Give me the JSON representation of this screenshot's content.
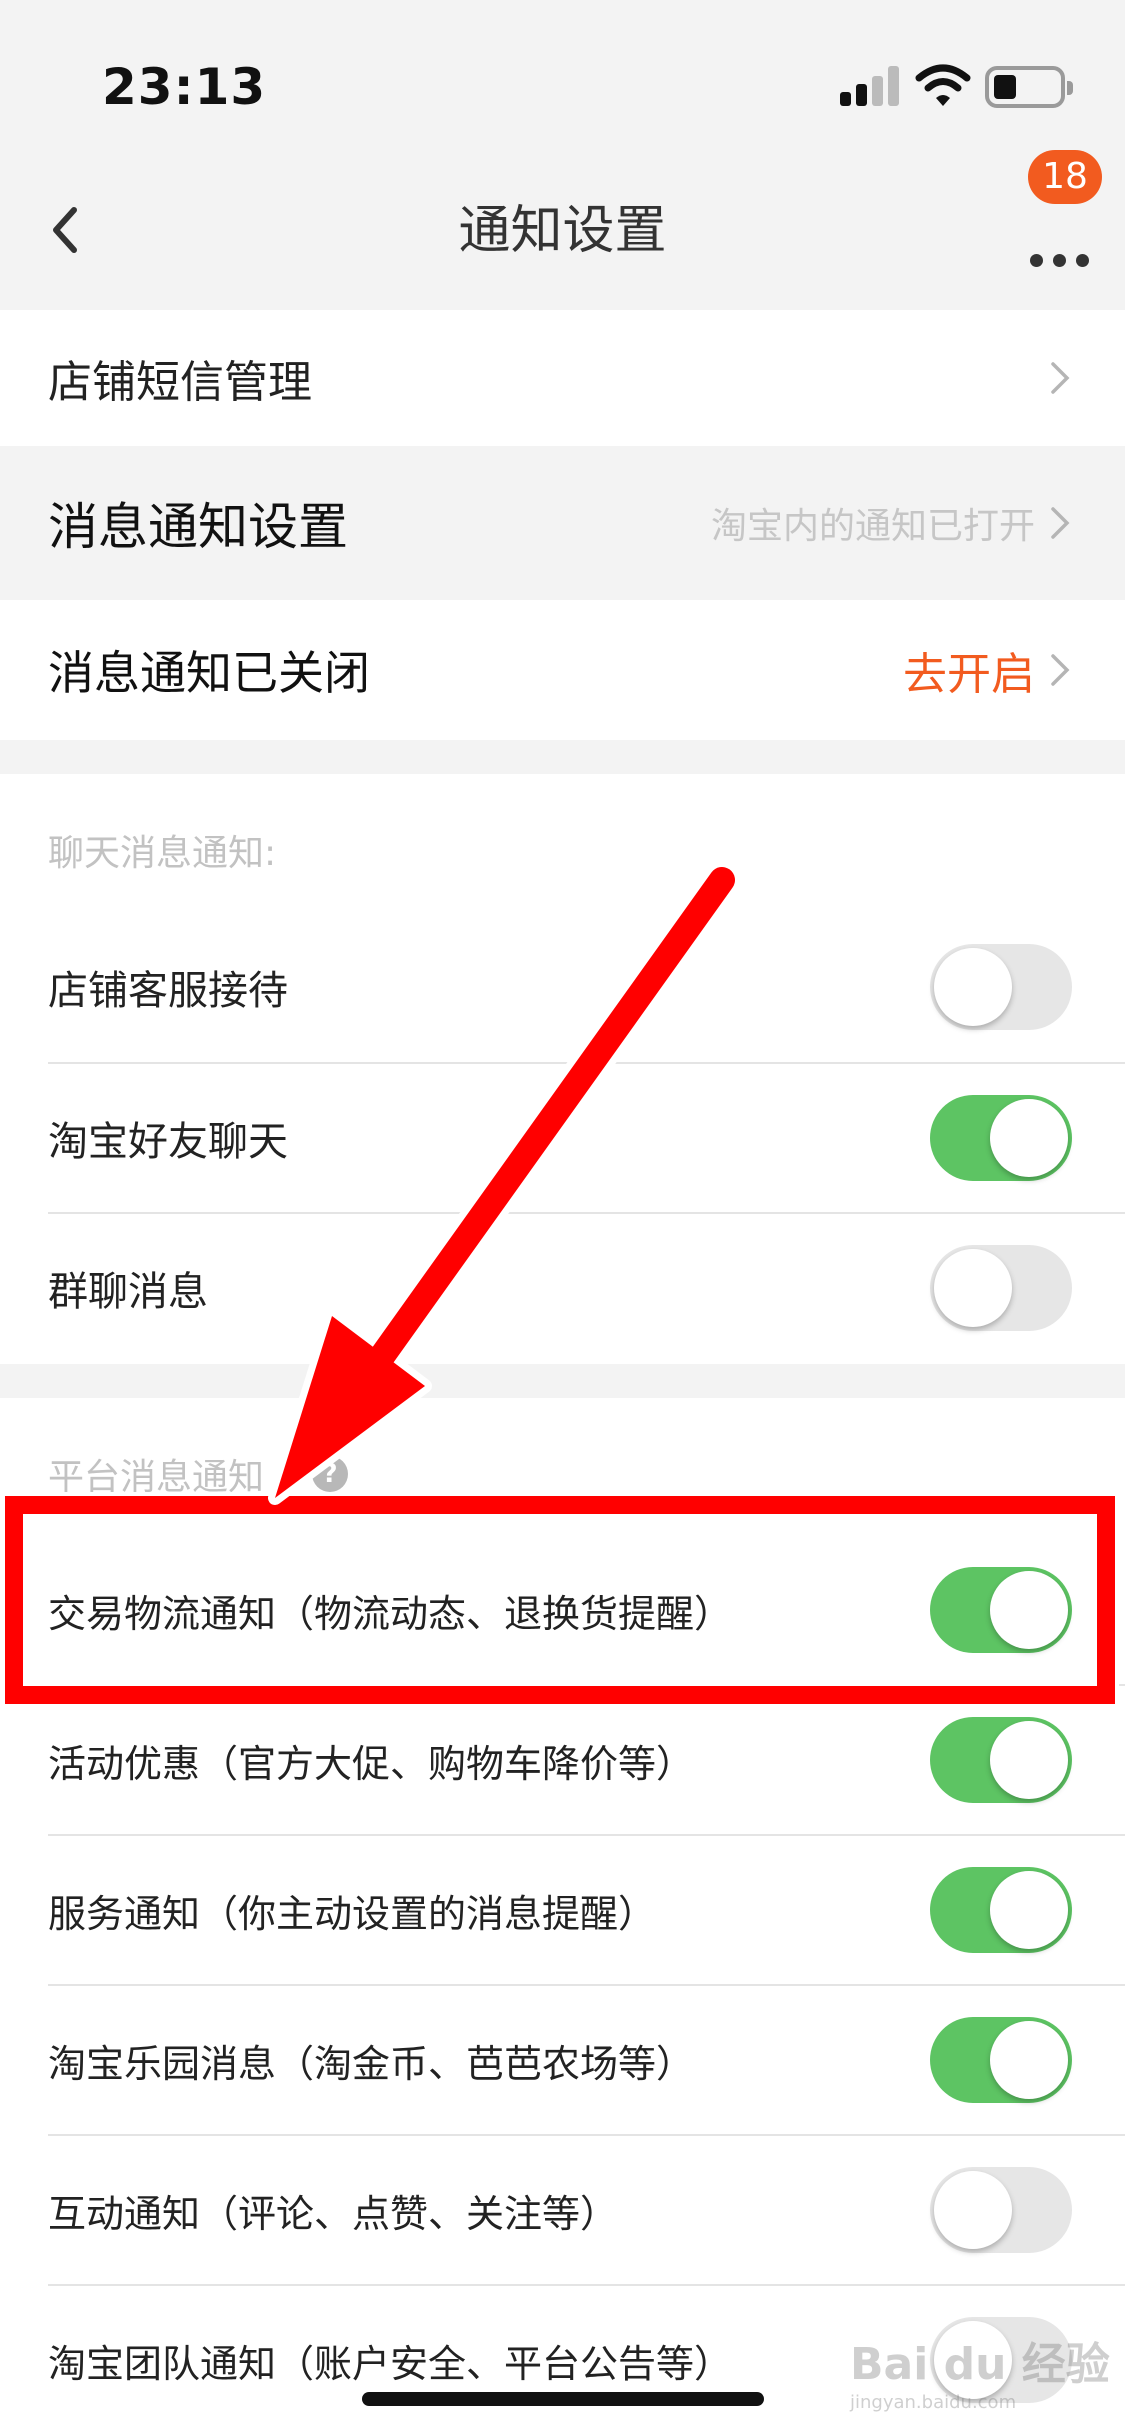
{
  "status": {
    "time": "23:13"
  },
  "nav": {
    "title": "通知设置",
    "badge": "18"
  },
  "rows": {
    "sms": {
      "label": "店铺短信管理"
    },
    "msg_settings": {
      "label": "消息通知设置",
      "value": "淘宝内的通知已打开"
    },
    "msg_closed": {
      "label": "消息通知已关闭",
      "action": "去开启"
    }
  },
  "chat": {
    "header": "聊天消息通知:",
    "items": [
      {
        "label": "店铺客服接待",
        "on": false
      },
      {
        "label": "淘宝好友聊天",
        "on": true
      },
      {
        "label": "群聊消息",
        "on": false
      }
    ]
  },
  "platform": {
    "header": "平台消息通知",
    "items": [
      {
        "label": "交易物流通知（物流动态、退换货提醒）",
        "on": true
      },
      {
        "label": "活动优惠（官方大促、购物车降价等）",
        "on": true
      },
      {
        "label": "服务通知（你主动设置的消息提醒）",
        "on": true
      },
      {
        "label": "淘宝乐园消息（淘金币、芭芭农场等）",
        "on": true
      },
      {
        "label": "互动通知（评论、点赞、关注等）",
        "on": false
      },
      {
        "label": "淘宝团队通知（账户安全、平台公告等）",
        "on": false
      }
    ]
  },
  "colors": {
    "accent_orange": "#f25b1f",
    "toggle_on": "#5dc463",
    "annotation_red": "#ff0000"
  },
  "watermark": {
    "text": "Bai du 经验",
    "sub": "jingyan.baidu.com"
  }
}
